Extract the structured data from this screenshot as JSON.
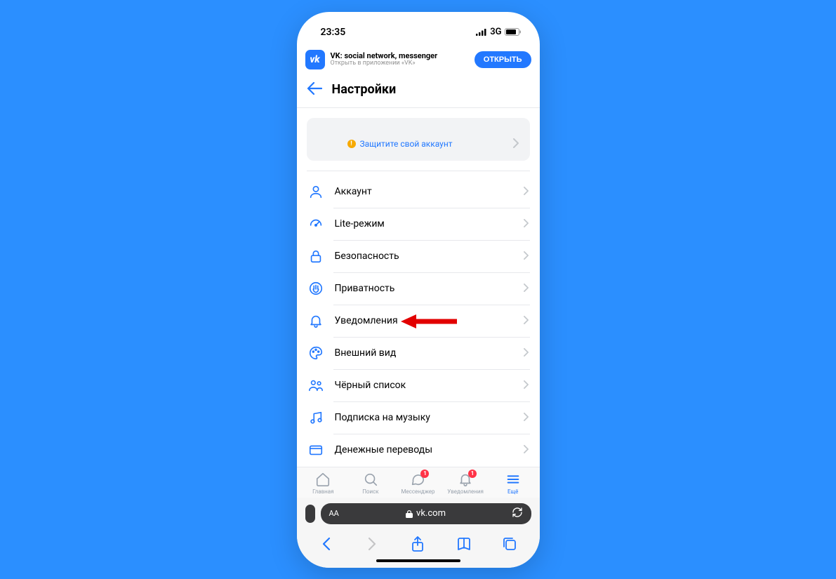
{
  "status": {
    "time": "23:35",
    "network": "3G"
  },
  "banner": {
    "logo_text": "vk",
    "title": "VK: social network, messenger",
    "subtitle": "Открыть в приложении «VK»",
    "button": "ОТКРЫТЬ"
  },
  "header": {
    "title": "Настройки"
  },
  "protect_card": {
    "text": "Защитите свой аккаунт"
  },
  "menu": [
    {
      "icon": "account",
      "label": "Аккаунт"
    },
    {
      "icon": "lite",
      "label": "Lite-режим"
    },
    {
      "icon": "lock",
      "label": "Безопасность"
    },
    {
      "icon": "hand",
      "label": "Приватность"
    },
    {
      "icon": "bell",
      "label": "Уведомления"
    },
    {
      "icon": "palette",
      "label": "Внешний вид"
    },
    {
      "icon": "users",
      "label": "Чёрный список"
    },
    {
      "icon": "music",
      "label": "Подписка на музыку"
    },
    {
      "icon": "card",
      "label": "Денежные переводы"
    }
  ],
  "bottomnav": [
    {
      "label": "Главная",
      "icon": "home",
      "badge": null,
      "active": false
    },
    {
      "label": "Поиск",
      "icon": "search",
      "badge": null,
      "active": false
    },
    {
      "label": "Мессенджер",
      "icon": "chat",
      "badge": "1",
      "active": false
    },
    {
      "label": "Уведомления",
      "icon": "notif",
      "badge": "1",
      "active": false
    },
    {
      "label": "Ещё",
      "icon": "menu",
      "badge": null,
      "active": true
    }
  ],
  "url_bar": {
    "aa": "AA",
    "domain": "vk.com"
  }
}
